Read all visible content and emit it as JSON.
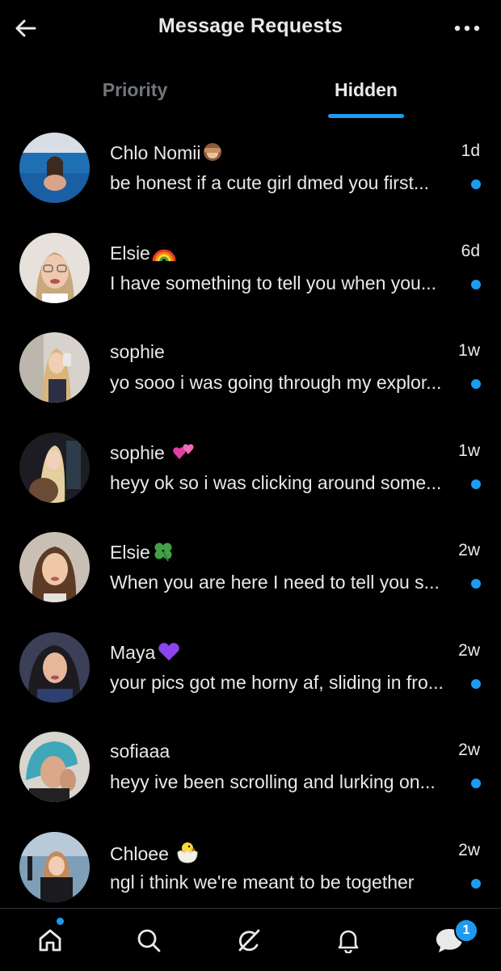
{
  "header": {
    "title": "Message Requests",
    "back_icon": "arrow-left-icon",
    "more_icon": "more-horizontal-icon"
  },
  "tabs": [
    {
      "label": "Priority",
      "active": false
    },
    {
      "label": "Hidden",
      "active": true
    }
  ],
  "conversations": [
    {
      "name": "Chlo Nomii",
      "emoji": "see-no-evil-monkey",
      "time": "1d",
      "preview": "be honest if a cute girl dmed you first...",
      "unread": true
    },
    {
      "name": "Elsie",
      "emoji": "rainbow",
      "time": "6d",
      "preview": "I have something to tell you when you...",
      "unread": true
    },
    {
      "name": "sophie",
      "emoji": "",
      "time": "1w",
      "preview": "yo sooo i was going through my explor...",
      "unread": true
    },
    {
      "name": "sophie",
      "emoji": "two-hearts",
      "time": "1w",
      "preview": "heyy ok so i was clicking around some...",
      "unread": true
    },
    {
      "name": "Elsie",
      "emoji": "four-leaf-clover",
      "time": "2w",
      "preview": "When you are here I need to tell you s...",
      "unread": true
    },
    {
      "name": "Maya",
      "emoji": "purple-heart",
      "time": "2w",
      "preview": "your pics got me horny af, sliding in fro...",
      "unread": true
    },
    {
      "name": "sofiaaa",
      "emoji": "",
      "time": "2w",
      "preview": "heyy ive been scrolling and lurking on...",
      "unread": true
    },
    {
      "name": "Chloee",
      "emoji": "hatching-chick",
      "time": "2w",
      "preview": "ngl i think we're meant to be together",
      "unread": true
    }
  ],
  "bottom_nav": {
    "items": [
      "home-icon",
      "search-icon",
      "grok-icon",
      "notifications-bell-icon",
      "messages-icon"
    ],
    "messages_badge": "1"
  },
  "colors": {
    "background": "#000000",
    "accent": "#1d9bf0",
    "text_primary": "#e7e9ea",
    "text_secondary": "#71767b"
  }
}
